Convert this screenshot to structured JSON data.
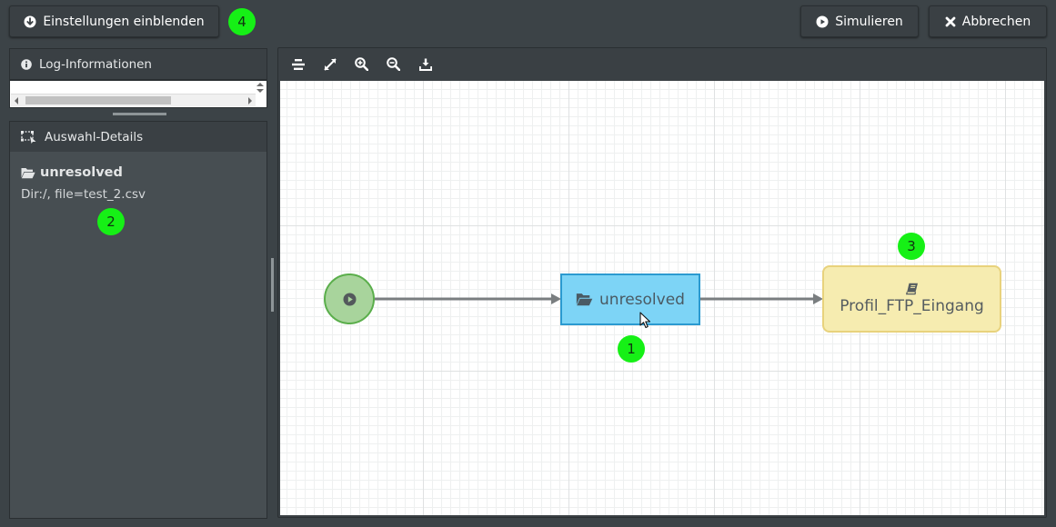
{
  "header": {
    "settings_button": "Einstellungen einblenden",
    "simulate_button": "Simulieren",
    "cancel_button": "Abbrechen"
  },
  "markers": [
    "1",
    "2",
    "3",
    "4"
  ],
  "log_panel": {
    "title": "Log-Informationen"
  },
  "details_panel": {
    "title": "Auswahl-Details",
    "selected_name": "unresolved",
    "selected_info": "Dir:/, file=test_2.csv"
  },
  "workflow": {
    "nodes": [
      {
        "type": "start",
        "icon": "play-circle-icon"
      },
      {
        "type": "directory",
        "label": "unresolved",
        "icon": "folder-open-icon"
      },
      {
        "type": "profile",
        "label": "Profil_FTP_Eingang",
        "icon": "book-icon"
      }
    ]
  },
  "toolbar": {
    "tools": [
      "align-icon",
      "fullscreen-icon",
      "zoom-in-icon",
      "zoom-out-icon",
      "download-icon"
    ]
  },
  "colors": {
    "background": "#3c4347",
    "start_node_fill": "#a8d49c",
    "directory_node_fill": "#7dd4f6",
    "profile_node_fill": "#f6ecb0",
    "marker": "#16f016"
  }
}
